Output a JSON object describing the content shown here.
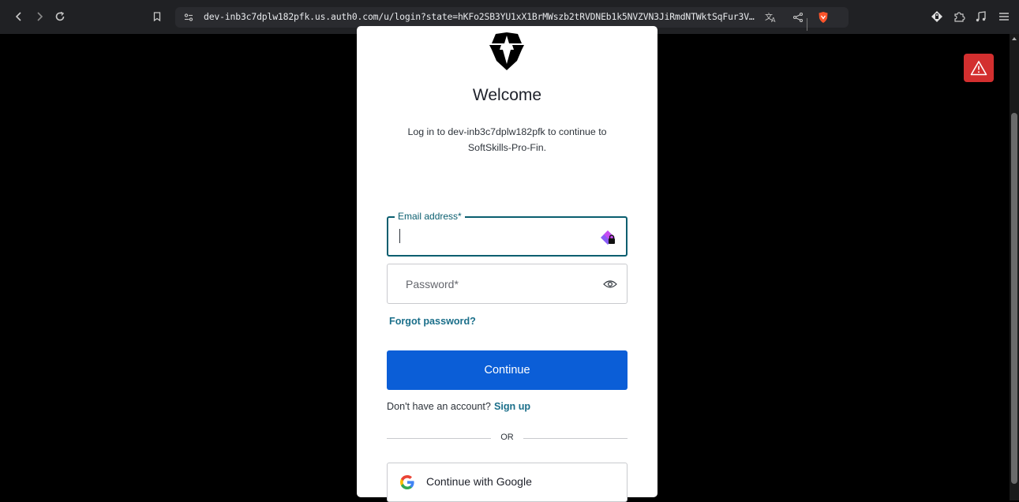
{
  "browser": {
    "url": "dev-inb3c7dplw182pfk.us.auth0.com/u/login?state=hKFo2SB3YU1xX1BrMWszb2tRVDNEb1k5NVZVN3JiRmdNTWktSqFur3Vu…",
    "icons": [
      "back-icon",
      "forward-icon",
      "reload-icon",
      "bookmark-icon",
      "site-settings-icon",
      "translate-icon",
      "share-icon",
      "brave-shields-icon",
      "wallet-icon",
      "extensions-icon",
      "media-icon",
      "menu-icon"
    ]
  },
  "page": {
    "warning_icon": "warning-icon"
  },
  "login": {
    "welcome": "Welcome",
    "subtitle": "Log in to dev-inb3c7dplw182pfk to continue to SoftSkills-Pro-Fin.",
    "email_label": "Email address*",
    "email_value": "",
    "password_placeholder": "Password*",
    "forgot_password": "Forgot password?",
    "continue_label": "Continue",
    "no_account_text": "Don't have an account?",
    "signup_label": "Sign up",
    "or_text": "OR",
    "google_label": "Continue with Google"
  },
  "colors": {
    "primary_button": "#0b5ed7",
    "link": "#1b6f8a",
    "focus_border": "#0a5e6f",
    "warning": "#d32f2f"
  }
}
